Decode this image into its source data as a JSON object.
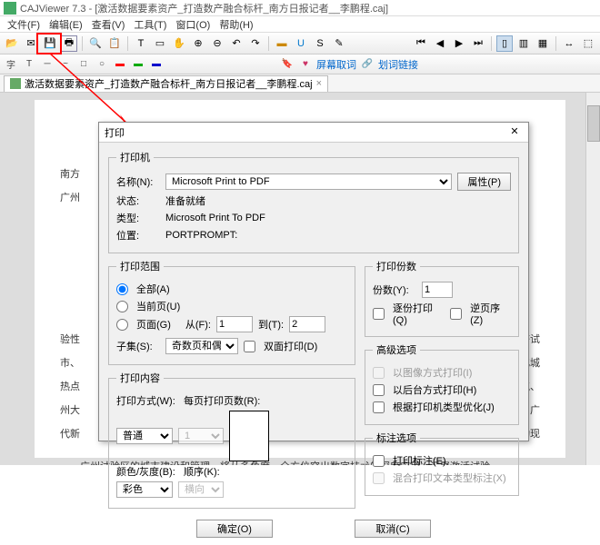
{
  "window": {
    "title": "CAJViewer 7.3 - [激活数据要素资产_打造数产融合标杆_南方日报记者__李鹏程.caj]"
  },
  "menu": {
    "file": "文件(F)",
    "edit": "编辑(E)",
    "view": "查看(V)",
    "tool": "工具(T)",
    "window": "窗口(O)",
    "help": "帮助(H)"
  },
  "tab": {
    "label": "激活数据要素资产_打造数产融合标杆_南方日报记者__李鹏程.caj"
  },
  "toolbar2": {
    "screenshot": "屏幕取词",
    "crosslink": "划词链接"
  },
  "doc": {
    "l1": "南方",
    "l2": "广州",
    "l3": "验性",
    "l4": "市、",
    "l5": "热点",
    "l6": "州大",
    "l7": "代新",
    "l8": "经济试",
    "l9": "跃化城",
    "l10": "电、气、",
    "l11": "项目：广",
    "l12": "推动现",
    "l13": "广州试验区的城市建设和管理，将从多角度、全方位突出数字技术的深度应用。汇聚激活试验"
  },
  "dlg": {
    "title": "打印",
    "printer": "打印机",
    "name_lbl": "名称(N):",
    "name_val": "Microsoft Print to PDF",
    "prop": "属性(P)",
    "status_lbl": "状态:",
    "status_val": "准备就绪",
    "type_lbl": "类型:",
    "type_val": "Microsoft Print To PDF",
    "loc_lbl": "位置:",
    "loc_val": "PORTPROMPT:",
    "range": "打印范围",
    "all": "全部(A)",
    "current": "当前页(U)",
    "pages": "页面(G)",
    "from": "从(F):",
    "from_v": "1",
    "to": "到(T):",
    "to_v": "2",
    "subset": "子集(S):",
    "subset_v": "奇数页和偶",
    "duplex": "双面打印(D)",
    "copies": "打印份数",
    "copies_lbl": "份数(Y):",
    "copies_v": "1",
    "collate": "逐份打印(Q)",
    "reverse": "逆页序(Z)",
    "adv": "高级选项",
    "img_mode": "以图像方式打印(I)",
    "back_mode": "以后台方式打印(H)",
    "opt_type": "根据打印机类型优化(J)",
    "content": "打印内容",
    "mode_lbl": "打印方式(W):",
    "mode_v": "普通",
    "ppp_lbl": "每页打印页数(R):",
    "ppp_v": "1",
    "color_lbl": "颜色/灰度(B):",
    "color_v": "彩色",
    "order_lbl": "顺序(K):",
    "order_v": "横向",
    "anno": "标注选项",
    "anno_print": "打印标注(E)",
    "anno_mix": "混合打印文本类型标注(X)",
    "ok": "确定(O)",
    "cancel": "取消(C)"
  }
}
